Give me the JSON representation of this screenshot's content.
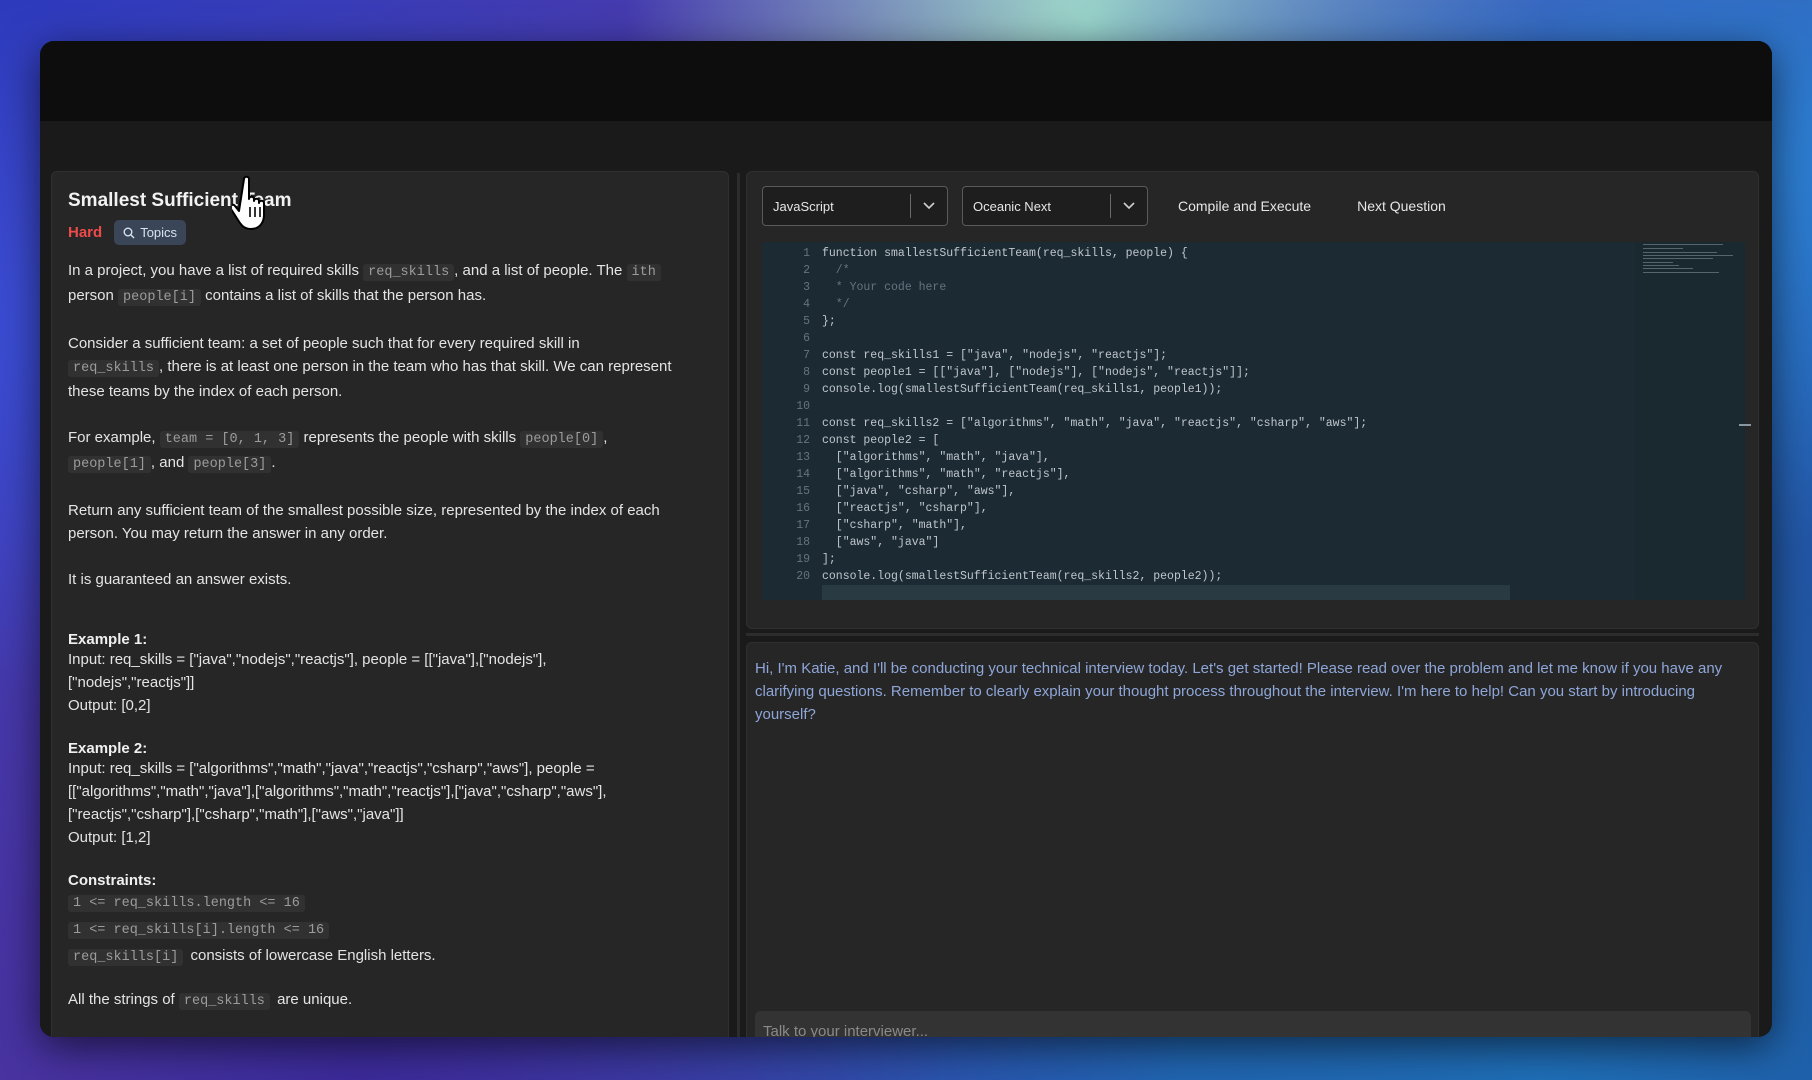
{
  "problem": {
    "title": "Smallest Sufficient Team",
    "difficulty": "Hard",
    "topics_label": "Topics",
    "para1": {
      "t1": "In a project, you have a list of required skills ",
      "c1": "req_skills",
      "t2": ", and a list of people. The ",
      "c2": "ith",
      "t3": " person ",
      "c3": "people[i]",
      "t4": " contains a list of skills that the person has."
    },
    "para2": {
      "t1": "Consider a sufficient team: a set of people such that for every required skill in ",
      "c1": "req_skills",
      "t2": ", there is at least one person in the team who has that skill. We can represent these teams by the index of each person."
    },
    "para3": {
      "t1": "For example, ",
      "c1": "team = [0, 1, 3]",
      "t2": " represents the people with skills ",
      "c2": "people[0]",
      "t3": ", ",
      "c3": "people[1]",
      "t4": ", and ",
      "c4": "people[3]",
      "t5": "."
    },
    "para4": "Return any sufficient team of the smallest possible size, represented by the index of each person. You may return the answer in any order.",
    "para5": "It is guaranteed an answer exists.",
    "example1": {
      "title": "Example 1:",
      "input": "Input: req_skills = [\"java\",\"nodejs\",\"reactjs\"], people = [[\"java\"],[\"nodejs\"],[\"nodejs\",\"reactjs\"]]",
      "output": "Output: [0,2]"
    },
    "example2": {
      "title": "Example 2:",
      "input": "Input: req_skills = [\"algorithms\",\"math\",\"java\",\"reactjs\",\"csharp\",\"aws\"], people = [[\"algorithms\",\"math\",\"java\"],[\"algorithms\",\"math\",\"reactjs\"],[\"java\",\"csharp\",\"aws\"],[\"reactjs\",\"csharp\"],[\"csharp\",\"math\"],[\"aws\",\"java\"]]",
      "output": "Output: [1,2]"
    },
    "constraints": {
      "title": "Constraints:",
      "c1": "1 <= req_skills.length <= 16",
      "c2": "1 <= req_skills[i].length <= 16",
      "c3_code": "req_skills[i]",
      "c3_text": " consists of lowercase English letters.",
      "c4_text": "All the strings of ",
      "c4_code": "req_skills",
      "c4_text2": " are unique."
    }
  },
  "editor": {
    "language": "JavaScript",
    "theme": "Oceanic Next",
    "compile_label": "Compile and Execute",
    "next_label": "Next Question",
    "lines": [
      {
        "n": "1",
        "code": "function smallestSufficientTeam(req_skills, people) {"
      },
      {
        "n": "2",
        "code": "  /*"
      },
      {
        "n": "3",
        "code": "  * Your code here"
      },
      {
        "n": "4",
        "code": "  */"
      },
      {
        "n": "5",
        "code": "};"
      },
      {
        "n": "6",
        "code": ""
      },
      {
        "n": "7",
        "code": "const req_skills1 = [\"java\", \"nodejs\", \"reactjs\"];"
      },
      {
        "n": "8",
        "code": "const people1 = [[\"java\"], [\"nodejs\"], [\"nodejs\", \"reactjs\"]];"
      },
      {
        "n": "9",
        "code": "console.log(smallestSufficientTeam(req_skills1, people1));"
      },
      {
        "n": "10",
        "code": ""
      },
      {
        "n": "11",
        "code": "const req_skills2 = [\"algorithms\", \"math\", \"java\", \"reactjs\", \"csharp\", \"aws\"];"
      },
      {
        "n": "12",
        "code": "const people2 = ["
      },
      {
        "n": "13",
        "code": "  [\"algorithms\", \"math\", \"java\"],"
      },
      {
        "n": "14",
        "code": "  [\"algorithms\", \"math\", \"reactjs\"],"
      },
      {
        "n": "15",
        "code": "  [\"java\", \"csharp\", \"aws\"],"
      },
      {
        "n": "16",
        "code": "  [\"reactjs\", \"csharp\"],"
      },
      {
        "n": "17",
        "code": "  [\"csharp\", \"math\"],"
      },
      {
        "n": "18",
        "code": "  [\"aws\", \"java\"]"
      },
      {
        "n": "19",
        "code": "];"
      },
      {
        "n": "20",
        "code": "console.log(smallestSufficientTeam(req_skills2, people2));"
      }
    ]
  },
  "chat": {
    "message": "Hi, I'm Katie, and I'll be conducting your technical interview today. Let's get started! Please read over the problem and let me know if you have any clarifying questions. Remember to clearly explain your thought process throughout the interview. I'm here to help! Can you start by introducing yourself?",
    "input_placeholder": "Talk to your interviewer..."
  },
  "colors": {
    "difficulty_hard": "#ef4a4a",
    "chat_text": "#8ea6d8",
    "editor_bg": "#1c2b33"
  },
  "icons": [
    "search-icon",
    "chevron-down-icon",
    "hand-pointer-cursor"
  ]
}
